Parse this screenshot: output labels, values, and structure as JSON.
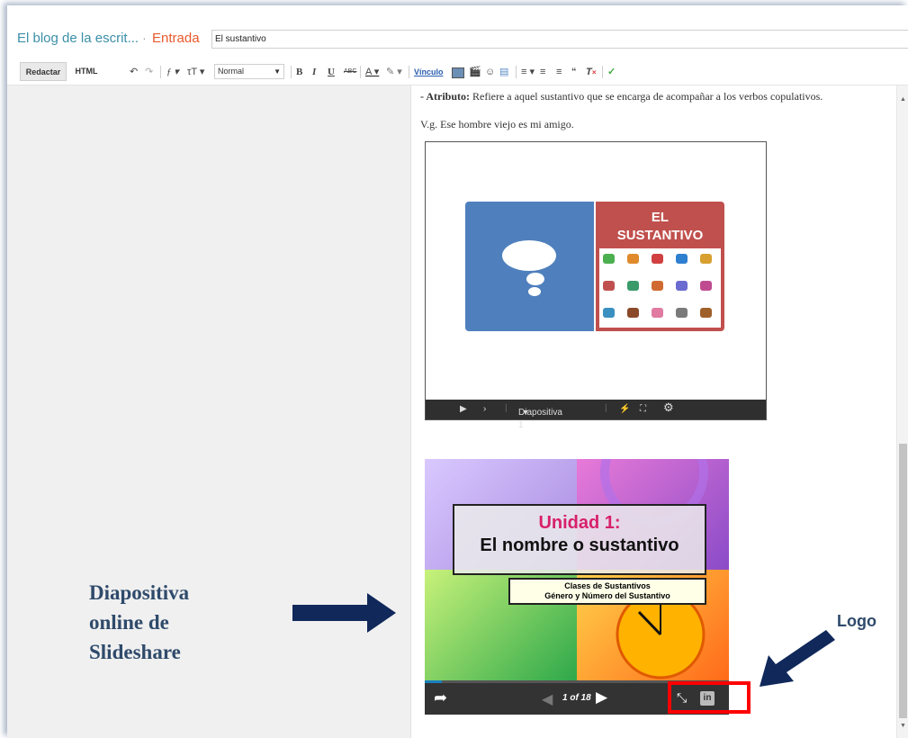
{
  "header": {
    "blog_title": "El blog de la escrit...",
    "separator": "·",
    "section": "Entrada",
    "post_title_value": "El sustantivo"
  },
  "toolbar": {
    "tab_compose": "Redactar",
    "tab_html": "HTML",
    "font_size_select": "Normal",
    "link_label": "Vínculo",
    "buttons": [
      "undo-icon",
      "redo-icon",
      "font-family-icon",
      "font-size-icon",
      "bold-icon",
      "italic-icon",
      "underline-icon",
      "strikethrough-icon",
      "text-color-icon",
      "highlight-icon",
      "link-icon",
      "image-icon",
      "video-icon",
      "emoji-icon",
      "page-break-icon",
      "align-icon",
      "numbered-list-icon",
      "bulleted-list-icon",
      "quote-icon",
      "clear-format-icon",
      "spellcheck-icon"
    ]
  },
  "content": {
    "line1_bold": "- Atributo:",
    "line1_rest": " Refiere a aquel sustantivo que se encarga de acompañar a los verbos copulativos.",
    "line2": "V.g. Ese hombre viejo es mi amigo."
  },
  "embed1": {
    "card_title_line1": "EL",
    "card_title_line2": "SUSTANTIVO",
    "slide_label": "Diapositiva 1"
  },
  "embed2": {
    "title_line1": "Unidad 1:",
    "title_line2": "El nombre o sustantivo",
    "subtitle_line1": "Clases de Sustantivos",
    "subtitle_line2": "Género y Número del Sustantivo",
    "page_indicator": "1 of 18",
    "progress_fraction": 0.056
  },
  "annotations": {
    "left_label_line1": "Diapositiva",
    "left_label_line2": "online de",
    "left_label_line3": "Slideshare",
    "logo_label": "Logo",
    "arrow_color": "#10285a",
    "highlight_color": "#ff0000"
  }
}
